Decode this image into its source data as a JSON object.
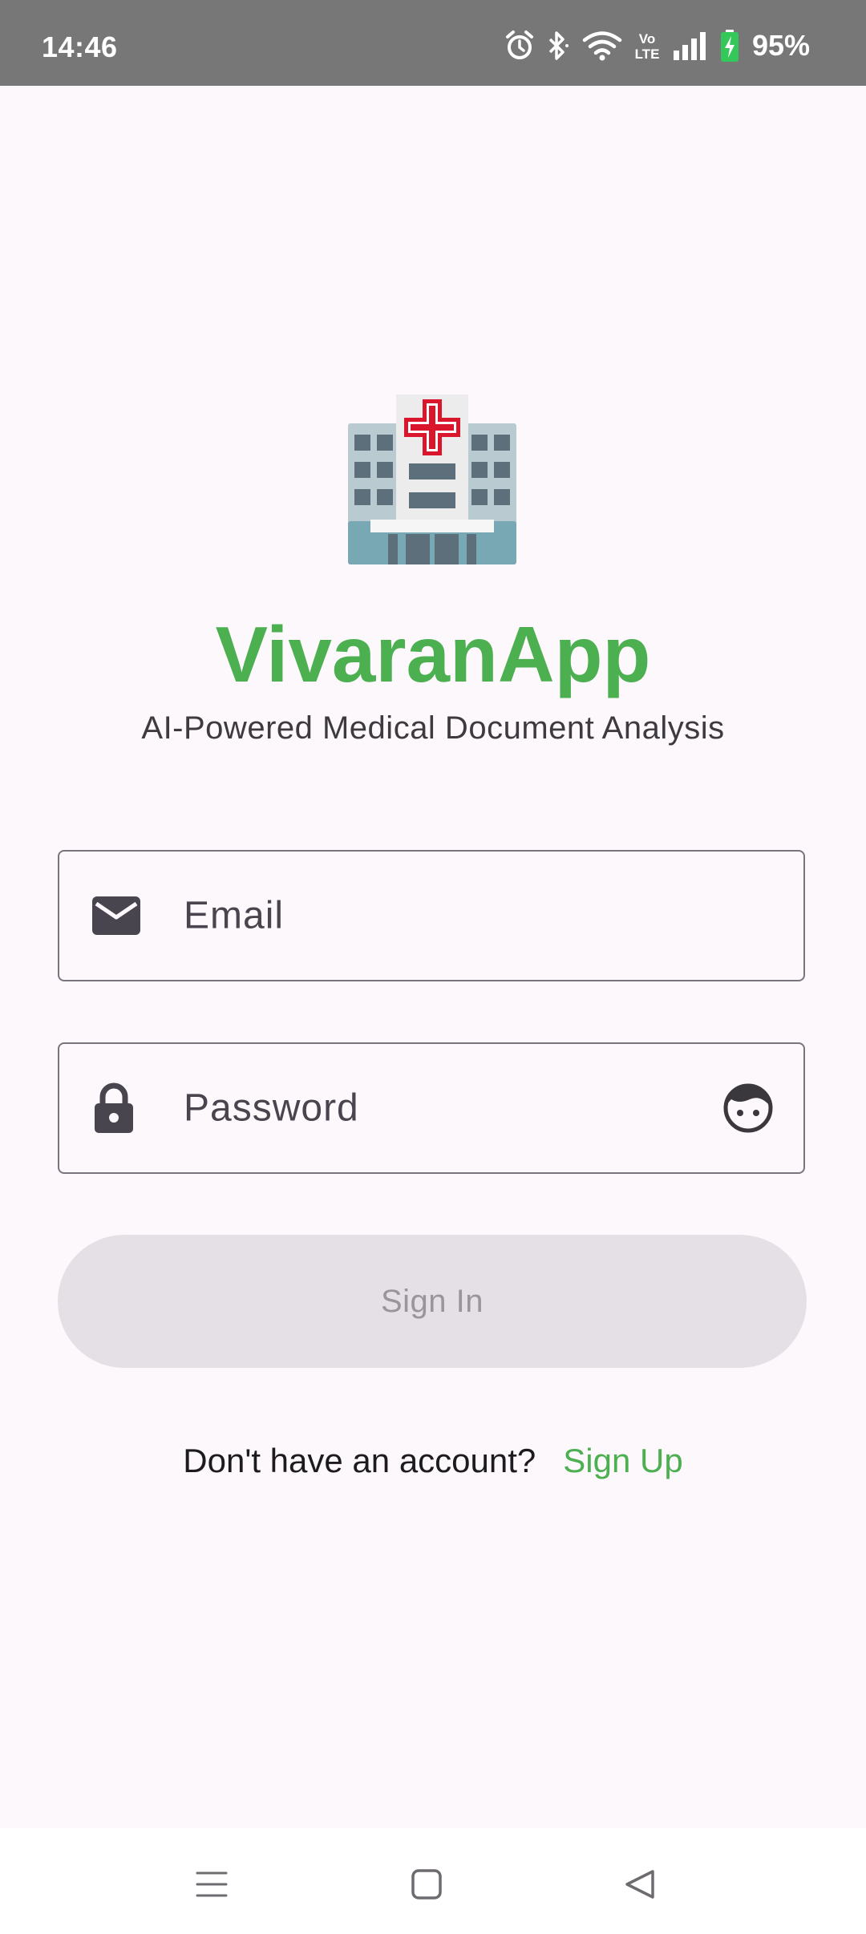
{
  "status_bar": {
    "time": "14:46",
    "battery": "95%",
    "network_label": "Vo\nLTE",
    "icons": [
      "alarm-icon",
      "bluetooth-icon",
      "wifi-icon",
      "volte-icon",
      "signal-icon",
      "battery-charging-icon"
    ]
  },
  "app": {
    "logo_icon": "hospital-icon",
    "title": "VivaranApp",
    "subtitle": "AI-Powered Medical Document Analysis",
    "accent_color": "#4caf50"
  },
  "form": {
    "email": {
      "placeholder": "Email",
      "value": "",
      "icon": "mail-icon"
    },
    "password": {
      "placeholder": "Password",
      "value": "",
      "icon": "lock-icon",
      "trailing_icon": "face-icon"
    },
    "submit_label": "Sign In"
  },
  "footer": {
    "prompt": "Don't have an account?",
    "link_label": "Sign Up"
  },
  "nav_bar": {
    "icons": [
      "menu-icon",
      "home-square-icon",
      "back-triangle-icon"
    ]
  }
}
